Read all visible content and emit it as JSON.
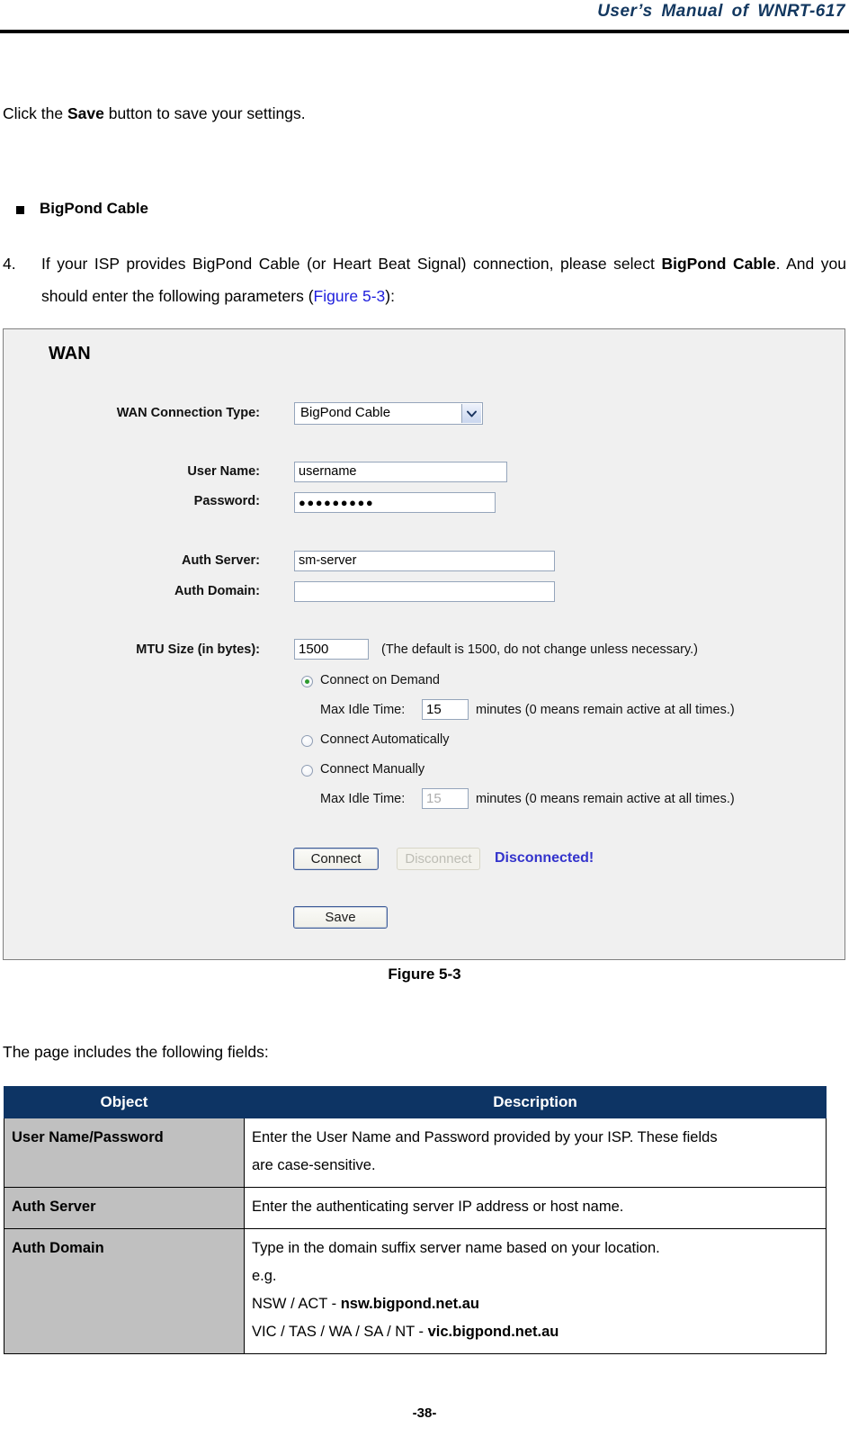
{
  "header": {
    "title": "User’s Manual of WNRT-617"
  },
  "body": {
    "click_save": {
      "prefix": "Click the ",
      "bold": "Save",
      "suffix": " button to save your settings."
    },
    "bullet_heading": "BigPond Cable",
    "numbered_item": {
      "index": "4.",
      "t1": "If your ISP provides BigPond Cable (or Heart Beat Signal) connection, please select ",
      "b1": "BigPond Cable",
      "t2": ". And you should enter the following parameters (",
      "link": "Figure 5-3",
      "t3": "):"
    },
    "includes_fields": "The page includes the following fields:",
    "figure_caption": "Figure 5-3",
    "page_number": "-38-"
  },
  "router": {
    "panel_title": "WAN",
    "labels": {
      "wan_connection_type": "WAN Connection Type:",
      "user_name": "User Name:",
      "password": "Password:",
      "auth_server": "Auth Server:",
      "auth_domain": "Auth Domain:",
      "mtu_size": "MTU Size (in bytes):",
      "max_idle_time": "Max Idle Time:"
    },
    "values": {
      "wan_connection_type": "BigPond Cable",
      "user_name": "username",
      "password": "●●●●●●●●●",
      "auth_server": "sm-server",
      "auth_domain": "",
      "mtu_size": "1500",
      "max_idle_time_demand": "15",
      "max_idle_time_manual": "15"
    },
    "notes": {
      "mtu_hint": "(The default is 1500, do not change unless necessary.)",
      "idle_hint_demand": "minutes (0 means remain active at all times.)",
      "idle_hint_manual": "minutes (0 means remain active at all times.)"
    },
    "radios": [
      {
        "label": "Connect on Demand",
        "checked": true
      },
      {
        "label": "Connect Automatically",
        "checked": false
      },
      {
        "label": "Connect Manually",
        "checked": false
      }
    ],
    "buttons": {
      "connect": "Connect",
      "disconnect": "Disconnect",
      "save": "Save"
    },
    "status": "Disconnected!",
    "colors": {
      "panel_background": "#f0f0f0",
      "status_text": "#3333cc",
      "radio_dot": "#2e9b2e",
      "input_border": "#95a5bb"
    }
  },
  "table": {
    "columns": [
      "Object",
      "Description"
    ],
    "rows": [
      {
        "object": "User Name/Password",
        "lines": [
          "Enter the User Name and Password provided by your ISP. These fields",
          "are case-sensitive."
        ]
      },
      {
        "object": "Auth Server",
        "lines": [
          "Enter the authenticating server IP address or host name."
        ]
      },
      {
        "object": "Auth Domain",
        "lines": [
          "Type in the domain suffix server name based on your location.",
          "e.g.",
          "NSW / ACT - nsw.bigpond.net.au",
          "VIC / TAS / WA / SA / NT - vic.bigpond.net.au"
        ],
        "bold_parts": [
          "nsw.bigpond.net.au",
          "vic.bigpond.net.au"
        ]
      }
    ],
    "colors": {
      "header_background": "#0d3464",
      "header_text": "#ffffff",
      "object_cell_background": "#c0c0c0"
    }
  }
}
